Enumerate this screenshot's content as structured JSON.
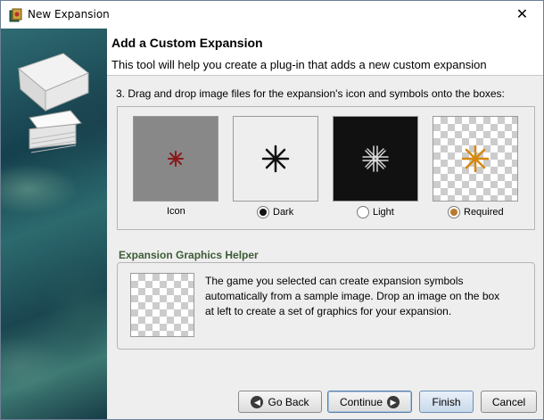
{
  "window": {
    "title": "New Expansion",
    "close_glyph": "✕"
  },
  "header": {
    "title": "Add a Custom Expansion",
    "description": "This tool will help you create a plug-in that adds a new custom expansion"
  },
  "step": {
    "label": "3. Drag and drop image files for the expansion's icon and symbols onto the boxes:"
  },
  "symbols": [
    {
      "label": "Icon",
      "background": "#888888",
      "symbol_color": "#8b1a1a",
      "has_radio": false
    },
    {
      "label": "Dark",
      "background": "#eeeeee",
      "symbol_color": "#111111",
      "has_radio": true,
      "radio_color": "#111111",
      "selected": true
    },
    {
      "label": "Light",
      "background": "#111111",
      "symbol_color": "#d8d8d8",
      "has_radio": true,
      "radio_color": "#ffffff",
      "selected": false
    },
    {
      "label": "Required",
      "background": "checkerboard",
      "symbol_color": "#d4880f",
      "has_radio": true,
      "radio_color": "#b87a2a",
      "selected": false
    }
  ],
  "helper": {
    "title": "Expansion Graphics Helper",
    "text": "The game you selected can create expansion symbols automatically from a sample image. Drop an image on the box at left to create a set of graphics for your expansion."
  },
  "buttons": {
    "back": "Go Back",
    "continue": "Continue",
    "finish": "Finish",
    "cancel": "Cancel"
  },
  "icons": {
    "back": "arrow-left-icon",
    "continue": "arrow-right-icon"
  }
}
